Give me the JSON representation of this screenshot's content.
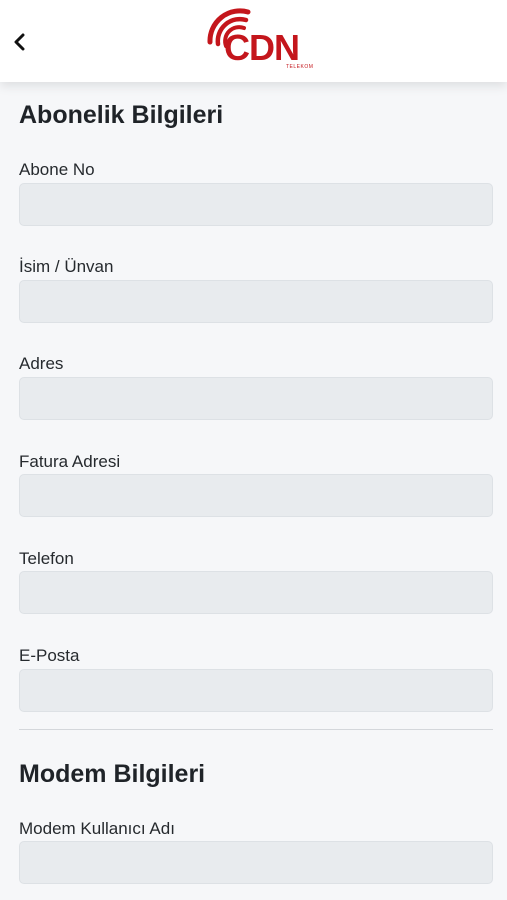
{
  "header": {
    "back_icon": "chevron-left-icon",
    "logo": {
      "text": "CDN",
      "subtext": "TELEKOM",
      "brand_color": "#c4161c"
    }
  },
  "subscription": {
    "title": "Abonelik Bilgileri",
    "fields": [
      {
        "label": "Abone No",
        "value": ""
      },
      {
        "label": "İsim / Ünvan",
        "value": ""
      },
      {
        "label": "Adres",
        "value": ""
      },
      {
        "label": "Fatura Adresi",
        "value": ""
      },
      {
        "label": "Telefon",
        "value": ""
      },
      {
        "label": "E-Posta",
        "value": ""
      }
    ]
  },
  "modem": {
    "title": "Modem Bilgileri",
    "fields": [
      {
        "label": "Modem Kullanıcı Adı",
        "value": ""
      }
    ]
  }
}
